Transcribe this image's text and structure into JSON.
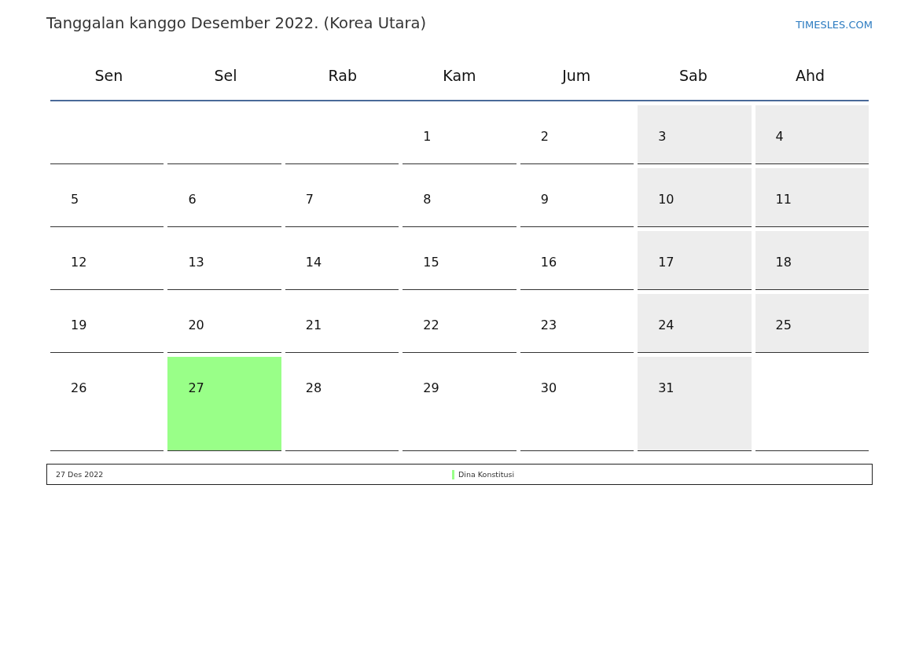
{
  "title": "Tanggalan kanggo Desember 2022. (Korea Utara)",
  "brand": "TIMESLES.COM",
  "weekdays": [
    "Sen",
    "Sel",
    "Rab",
    "Kam",
    "Jum",
    "Sab",
    "Ahd"
  ],
  "weeks": [
    [
      {
        "weekend": false,
        "highlight": false
      },
      {
        "weekend": false,
        "highlight": false
      },
      {
        "weekend": false,
        "highlight": false
      },
      {
        "day": "1",
        "weekend": false,
        "highlight": false
      },
      {
        "day": "2",
        "weekend": false,
        "highlight": false
      },
      {
        "day": "3",
        "weekend": true,
        "highlight": false
      },
      {
        "day": "4",
        "weekend": true,
        "highlight": false
      }
    ],
    [
      {
        "day": "5",
        "weekend": false,
        "highlight": false
      },
      {
        "day": "6",
        "weekend": false,
        "highlight": false
      },
      {
        "day": "7",
        "weekend": false,
        "highlight": false
      },
      {
        "day": "8",
        "weekend": false,
        "highlight": false
      },
      {
        "day": "9",
        "weekend": false,
        "highlight": false
      },
      {
        "day": "10",
        "weekend": true,
        "highlight": false
      },
      {
        "day": "11",
        "weekend": true,
        "highlight": false
      }
    ],
    [
      {
        "day": "12",
        "weekend": false,
        "highlight": false
      },
      {
        "day": "13",
        "weekend": false,
        "highlight": false
      },
      {
        "day": "14",
        "weekend": false,
        "highlight": false
      },
      {
        "day": "15",
        "weekend": false,
        "highlight": false
      },
      {
        "day": "16",
        "weekend": false,
        "highlight": false
      },
      {
        "day": "17",
        "weekend": true,
        "highlight": false
      },
      {
        "day": "18",
        "weekend": true,
        "highlight": false
      }
    ],
    [
      {
        "day": "19",
        "weekend": false,
        "highlight": false
      },
      {
        "day": "20",
        "weekend": false,
        "highlight": false
      },
      {
        "day": "21",
        "weekend": false,
        "highlight": false
      },
      {
        "day": "22",
        "weekend": false,
        "highlight": false
      },
      {
        "day": "23",
        "weekend": false,
        "highlight": false
      },
      {
        "day": "24",
        "weekend": true,
        "highlight": false
      },
      {
        "day": "25",
        "weekend": true,
        "highlight": false
      }
    ],
    [
      {
        "day": "26",
        "weekend": false,
        "highlight": false
      },
      {
        "day": "27",
        "weekend": false,
        "highlight": true
      },
      {
        "day": "28",
        "weekend": false,
        "highlight": false
      },
      {
        "day": "29",
        "weekend": false,
        "highlight": false
      },
      {
        "day": "30",
        "weekend": false,
        "highlight": false
      },
      {
        "day": "31",
        "weekend": true,
        "highlight": false
      },
      {
        "weekend": false,
        "highlight": false
      }
    ]
  ],
  "holidays": [
    {
      "date": "27 Des 2022",
      "name": "Dina Konstitusi",
      "color": "#99ff88"
    }
  ]
}
